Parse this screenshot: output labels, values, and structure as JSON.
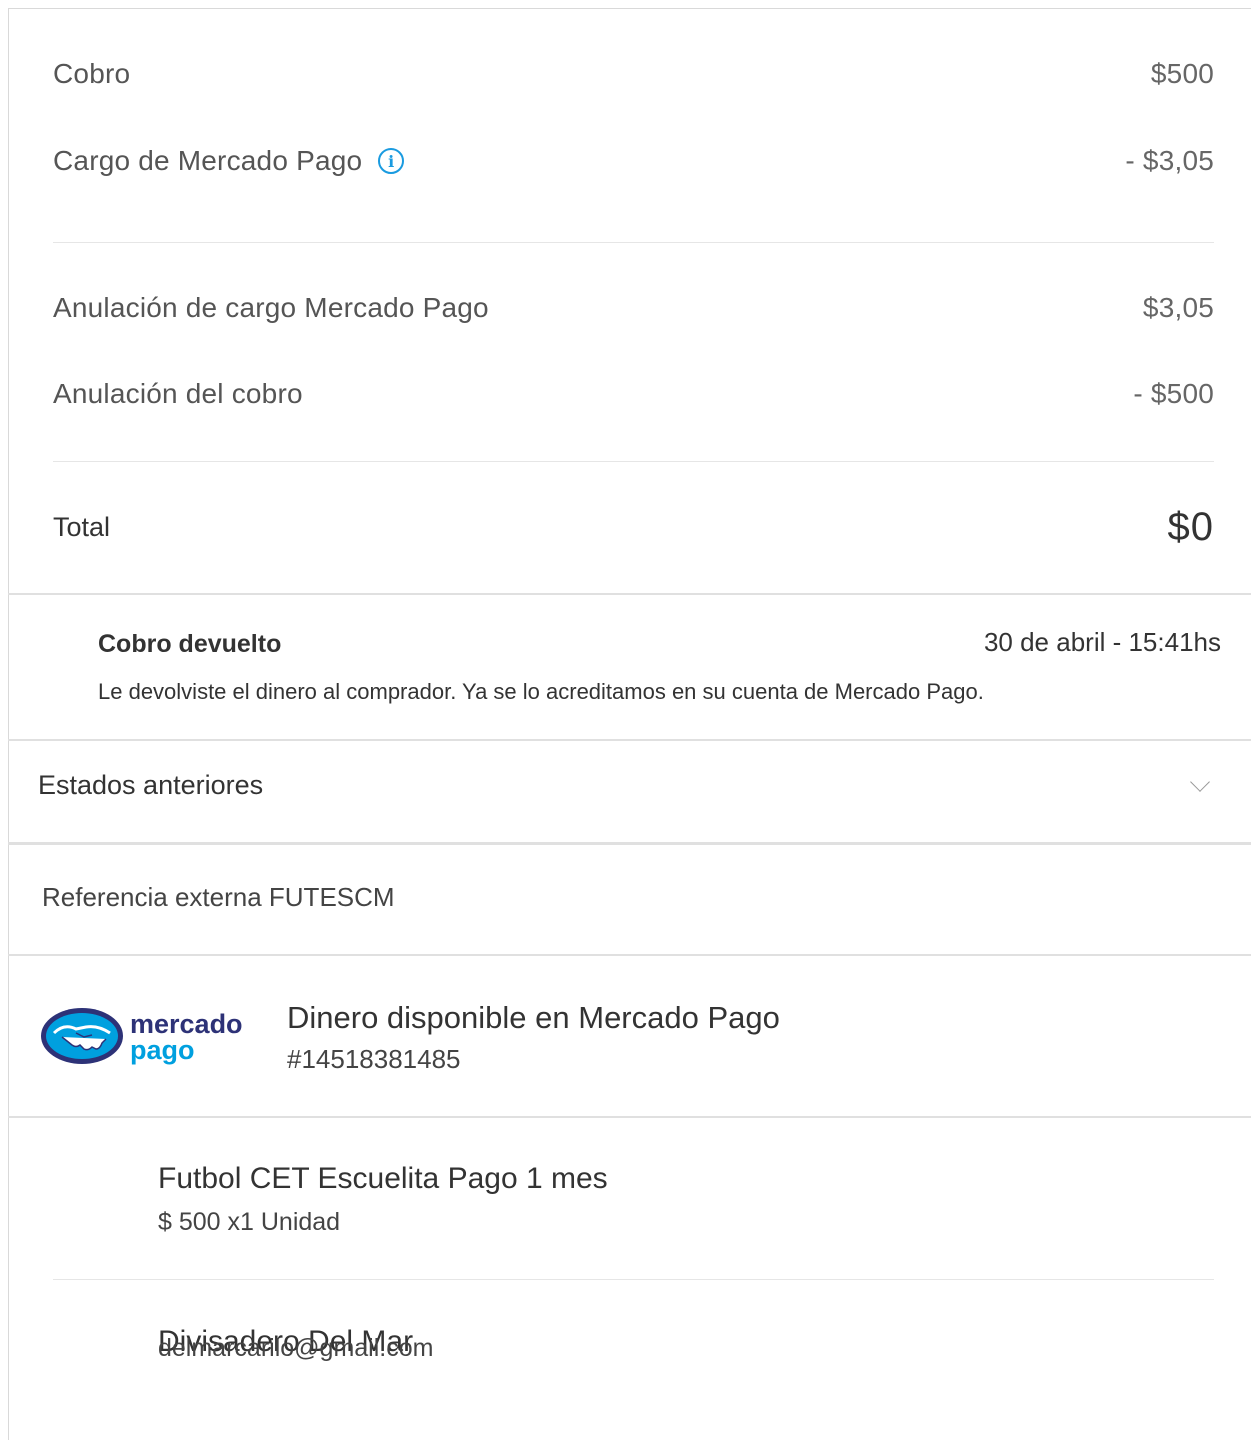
{
  "summary": {
    "rows": [
      {
        "label": "Cobro",
        "amount": "$500"
      },
      {
        "label": "Cargo de Mercado Pago",
        "amount": "- $3,05"
      },
      {
        "label": "Anulación de cargo Mercado Pago",
        "amount": "$3,05"
      },
      {
        "label": "Anulación del cobro",
        "amount": "- $500"
      }
    ],
    "info_icon_glyph": "i",
    "total_label": "Total",
    "total_amount": "$0"
  },
  "status": {
    "title": "Cobro devuelto",
    "date": "30 de abril - 15:41hs",
    "description": "Le devolviste el dinero al comprador. Ya se lo acreditamos en su cuenta de Mercado Pago."
  },
  "previous_states": {
    "label": "Estados anteriores"
  },
  "reference": {
    "label": "Referencia externa FUTESCM"
  },
  "payment_method": {
    "logo_line1": "mercado",
    "logo_line2": "pago",
    "title": "Dinero disponible en Mercado Pago",
    "id": "#14518381485"
  },
  "item": {
    "title": "Futbol CET Escuelita Pago 1 mes",
    "detail": "$ 500 x1 Unidad"
  },
  "buyer": {
    "name": "Divisadero Del Mar",
    "email": "delmarcarilo@gmail.com"
  },
  "colors": {
    "accent": "#1a9be0",
    "logo_navy": "#2d3277",
    "logo_blue": "#00a0df"
  }
}
